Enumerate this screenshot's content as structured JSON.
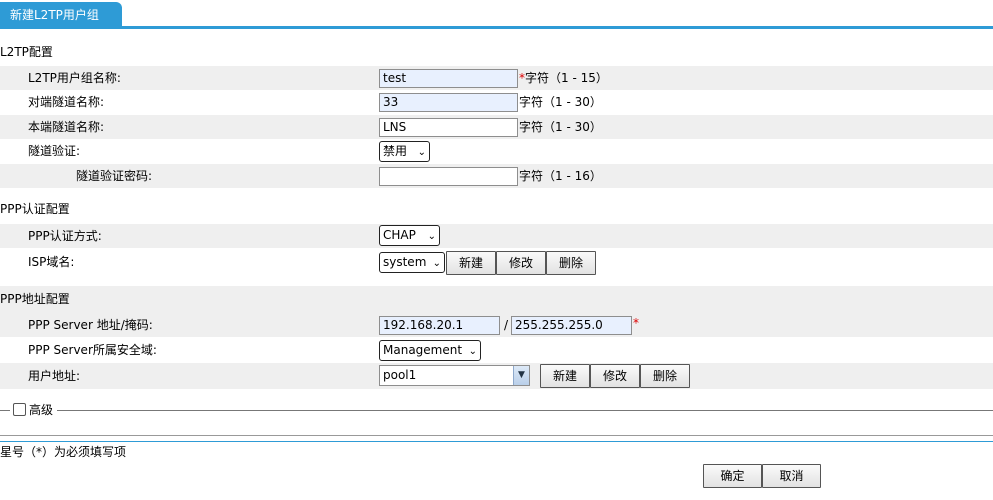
{
  "tab": {
    "label": "新建L2TP用户组"
  },
  "sections": {
    "l2tp": "L2TP配置",
    "ppp_auth": "PPP认证配置",
    "ppp_addr": "PPP地址配置"
  },
  "fields": {
    "group_name": {
      "label": "L2TP用户组名称:",
      "value": "test",
      "required": "*",
      "hint": "字符（1 - 15）"
    },
    "peer_tunnel": {
      "label": "对端隧道名称:",
      "value": "33",
      "hint": "字符（1 - 30）"
    },
    "local_tunnel": {
      "label": "本端隧道名称:",
      "value": "LNS",
      "hint": "字符（1 - 30）"
    },
    "tunnel_auth": {
      "label": "隧道验证:",
      "value": "禁用"
    },
    "tunnel_auth_pwd": {
      "label": "隧道验证密码:",
      "value": "",
      "hint": "字符（1 - 16）"
    },
    "ppp_auth_mode": {
      "label": "PPP认证方式:",
      "value": "CHAP"
    },
    "isp_domain": {
      "label": "ISP域名:",
      "value": "system"
    },
    "server_addr": {
      "label": "PPP Server 地址/掩码:",
      "ip": "192.168.20.1",
      "sep": "/",
      "mask": "255.255.255.0",
      "required": "*"
    },
    "server_zone": {
      "label": "PPP Server所属安全域:",
      "value": "Management"
    },
    "user_addr": {
      "label": "用户地址:",
      "value": "pool1"
    }
  },
  "buttons": {
    "new": "新建",
    "modify": "修改",
    "delete": "删除",
    "ok": "确定",
    "cancel": "取消"
  },
  "advanced": {
    "label": "高级"
  },
  "note": "星号（*）为必须填写项",
  "colors": {
    "accent": "#2e9bd6",
    "row_shade": "#efefef",
    "input_autofill": "#e8f0fe",
    "required": "#dd0000"
  }
}
